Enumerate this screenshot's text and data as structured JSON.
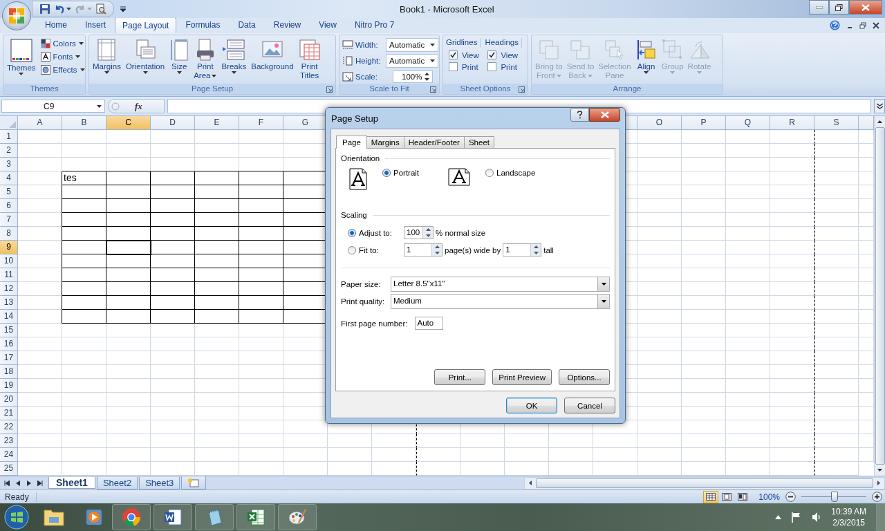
{
  "title_bar": {
    "title": "Book1 - Microsoft Excel"
  },
  "tabs": [
    {
      "label": "Home",
      "selected": false
    },
    {
      "label": "Insert",
      "selected": false
    },
    {
      "label": "Page Layout",
      "selected": true
    },
    {
      "label": "Formulas",
      "selected": false
    },
    {
      "label": "Data",
      "selected": false
    },
    {
      "label": "Review",
      "selected": false
    },
    {
      "label": "View",
      "selected": false
    },
    {
      "label": "Nitro Pro 7",
      "selected": false
    }
  ],
  "ribbon": {
    "themes": {
      "label": "Themes",
      "big": "Themes",
      "small": [
        "Colors",
        "Fonts",
        "Effects"
      ]
    },
    "page_setup": {
      "label": "Page Setup",
      "buttons": [
        {
          "lines": [
            "Margins"
          ],
          "dropdown": true
        },
        {
          "lines": [
            "Orientation"
          ],
          "dropdown": true
        },
        {
          "lines": [
            "Size"
          ],
          "dropdown": true
        },
        {
          "lines": [
            "Print",
            "Area"
          ],
          "dropdown": true
        },
        {
          "lines": [
            "Breaks"
          ],
          "dropdown": true
        },
        {
          "lines": [
            "Background"
          ],
          "dropdown": false
        },
        {
          "lines": [
            "Print",
            "Titles"
          ],
          "dropdown": false
        }
      ]
    },
    "scale_to_fit": {
      "label": "Scale to Fit",
      "width": {
        "label": "Width:",
        "value": "Automatic"
      },
      "height": {
        "label": "Height:",
        "value": "Automatic"
      },
      "scale": {
        "label": "Scale:",
        "value": "100%"
      }
    },
    "sheet_options": {
      "label": "Sheet Options",
      "groups": [
        {
          "heading": "Gridlines",
          "view": {
            "label": "View",
            "checked": true
          },
          "print": {
            "label": "Print",
            "checked": false
          }
        },
        {
          "heading": "Headings",
          "view": {
            "label": "View",
            "checked": true
          },
          "print": {
            "label": "Print",
            "checked": false
          }
        }
      ]
    },
    "arrange": {
      "label": "Arrange",
      "buttons": [
        {
          "lines": [
            "Bring to",
            "Front"
          ],
          "disabled": true,
          "dropdown": true
        },
        {
          "lines": [
            "Send to",
            "Back"
          ],
          "disabled": true,
          "dropdown": true
        },
        {
          "lines": [
            "Selection",
            "Pane"
          ],
          "disabled": true,
          "dropdown": false
        },
        {
          "lines": [
            "Align"
          ],
          "disabled": false,
          "dropdown": true
        },
        {
          "lines": [
            "Group"
          ],
          "disabled": true,
          "dropdown": true
        },
        {
          "lines": [
            "Rotate"
          ],
          "disabled": true,
          "dropdown": true
        }
      ]
    }
  },
  "formula_bar": {
    "name_box": "C9",
    "fx": "fx"
  },
  "sheet": {
    "columns_left": [
      {
        "label": "A",
        "selected": false
      },
      {
        "label": "B",
        "selected": false
      },
      {
        "label": "C",
        "selected": true
      },
      {
        "label": "D",
        "selected": false
      },
      {
        "label": "E",
        "selected": false
      },
      {
        "label": "F",
        "selected": false
      },
      {
        "label": "G",
        "selected": false
      }
    ],
    "columns_right": [
      {
        "label": "O",
        "selected": false
      },
      {
        "label": "P",
        "selected": false
      },
      {
        "label": "Q",
        "selected": false
      },
      {
        "label": "R",
        "selected": false
      },
      {
        "label": "S",
        "selected": false
      }
    ],
    "rows": [
      {
        "label": "1",
        "selected": false
      },
      {
        "label": "2",
        "selected": false
      },
      {
        "label": "3",
        "selected": false
      },
      {
        "label": "4",
        "selected": false
      },
      {
        "label": "5",
        "selected": false
      },
      {
        "label": "6",
        "selected": false
      },
      {
        "label": "7",
        "selected": false
      },
      {
        "label": "8",
        "selected": false
      },
      {
        "label": "9",
        "selected": true
      },
      {
        "label": "10",
        "selected": false
      },
      {
        "label": "11",
        "selected": false
      },
      {
        "label": "12",
        "selected": false
      },
      {
        "label": "13",
        "selected": false
      },
      {
        "label": "14",
        "selected": false
      },
      {
        "label": "15",
        "selected": false
      },
      {
        "label": "16",
        "selected": false
      },
      {
        "label": "17",
        "selected": false
      },
      {
        "label": "18",
        "selected": false
      },
      {
        "label": "19",
        "selected": false
      },
      {
        "label": "20",
        "selected": false
      },
      {
        "label": "21",
        "selected": false
      },
      {
        "label": "22",
        "selected": false
      },
      {
        "label": "23",
        "selected": false
      },
      {
        "label": "24",
        "selected": false
      },
      {
        "label": "25",
        "selected": false
      }
    ],
    "cell_b4": "tes"
  },
  "dialog": {
    "title": "Page Setup",
    "tabs": [
      {
        "label": "Page",
        "selected": true
      },
      {
        "label": "Margins",
        "selected": false
      },
      {
        "label": "Header/Footer",
        "selected": false
      },
      {
        "label": "Sheet",
        "selected": false
      }
    ],
    "orientation": {
      "heading": "Orientation",
      "options": [
        {
          "label": "Portrait",
          "selected": true
        },
        {
          "label": "Landscape",
          "selected": false
        }
      ]
    },
    "scaling": {
      "heading": "Scaling",
      "adjust": {
        "label": "Adjust to:",
        "selected": true,
        "value": "100",
        "suffix": "% normal size"
      },
      "fit": {
        "label": "Fit to:",
        "selected": false,
        "wide": "1",
        "wide_suffix": "page(s) wide by",
        "tall": "1",
        "tall_suffix": "tall"
      }
    },
    "paper_size": {
      "label": "Paper size:",
      "value": "Letter 8.5\"x11\""
    },
    "print_quality": {
      "label": "Print quality:",
      "value": "Medium"
    },
    "first_page_number": {
      "label": "First page number:",
      "value": "Auto"
    },
    "buttons": [
      "Print...",
      "Print Preview",
      "Options..."
    ],
    "footer_buttons": [
      {
        "label": "OK",
        "default": true
      },
      {
        "label": "Cancel",
        "default": false
      }
    ]
  },
  "sheet_tabs": [
    {
      "label": "Sheet1",
      "selected": true
    },
    {
      "label": "Sheet2",
      "selected": false
    },
    {
      "label": "Sheet3",
      "selected": false
    }
  ],
  "status_bar": {
    "text": "Ready",
    "views": [
      {
        "selected": true
      },
      {
        "selected": false
      },
      {
        "selected": false
      }
    ],
    "zoom": "100%",
    "zoom_slider": {
      "level": 0.5
    }
  },
  "taskbar": {
    "time": "10:39 AM",
    "date": "2/3/2015"
  }
}
